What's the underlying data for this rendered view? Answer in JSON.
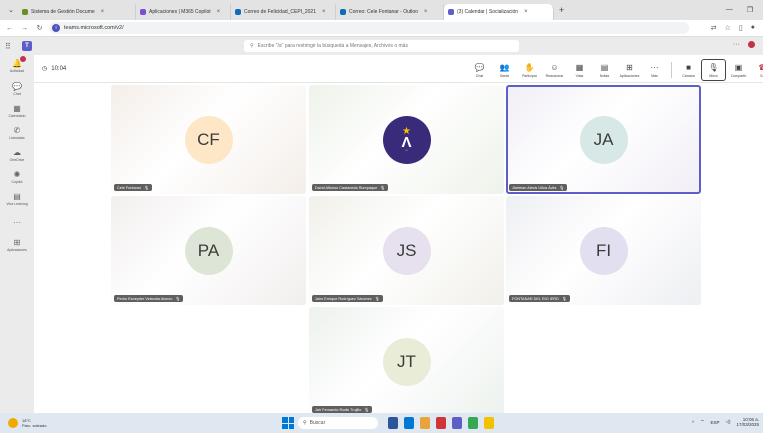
{
  "browser": {
    "tabs": [
      {
        "label": "Sistema de Gestión Docume",
        "color": "#6b8e23"
      },
      {
        "label": "Aplicaciones | M365 Copilot",
        "color": "#7a4fd6"
      },
      {
        "label": "Correo de Felicidad_CEPI_2021",
        "color": "#0f6cbd"
      },
      {
        "label": "Correo: Cele Fontanar - Outloo",
        "color": "#0f6cbd"
      },
      {
        "label": "(3) Calendar | Socialización",
        "color": "#5b5fc7",
        "active": true
      }
    ],
    "url": "teams.microsoft.com/v2/",
    "new_tab": "+"
  },
  "teams": {
    "search_placeholder": "Escribe \"/a\" para restringir la búsqueda a Mensajes, Archivos o más",
    "logo": "T",
    "rail": [
      {
        "label": "Actividad",
        "icon": "bell-icon",
        "glyph": "🔔",
        "badge": true
      },
      {
        "label": "Chat",
        "icon": "chat-icon",
        "glyph": "💬"
      },
      {
        "label": "Calendario",
        "icon": "calendar-icon",
        "glyph": "▦"
      },
      {
        "label": "Llamadas",
        "icon": "phone-icon",
        "glyph": "✆"
      },
      {
        "label": "OneDrive",
        "icon": "cloud-icon",
        "glyph": "☁"
      },
      {
        "label": "Copilot",
        "icon": "copilot-icon",
        "glyph": "✺"
      },
      {
        "label": "Viva Learning",
        "icon": "learning-icon",
        "glyph": "▤"
      },
      {
        "label": "",
        "icon": "more-icon",
        "glyph": "···"
      },
      {
        "label": "Aplicaciones",
        "icon": "apps-icon",
        "glyph": "⊞"
      }
    ]
  },
  "meeting": {
    "timer": "10:04",
    "controls": [
      {
        "label": "Chat",
        "icon": "chat-icon",
        "glyph": "💬"
      },
      {
        "label": "Gente",
        "icon": "people-icon",
        "glyph": "👥"
      },
      {
        "label": "Participar",
        "icon": "raise-hand-icon",
        "glyph": "✋"
      },
      {
        "label": "Reaccionar",
        "icon": "reaction-icon",
        "glyph": "☺"
      },
      {
        "label": "Vista",
        "icon": "view-icon",
        "glyph": "▦"
      },
      {
        "label": "Notas",
        "icon": "notes-icon",
        "glyph": "▤"
      },
      {
        "label": "Aplicaciones",
        "icon": "apps-icon",
        "glyph": "⊞"
      },
      {
        "label": "Más",
        "icon": "more-icon",
        "glyph": "···"
      }
    ],
    "device_controls": [
      {
        "label": "Cámara",
        "icon": "camera-off-icon",
        "glyph": "■"
      },
      {
        "label": "Micro",
        "icon": "mic-off-icon",
        "glyph": "🎙"
      },
      {
        "label": "Compartir",
        "icon": "share-icon",
        "glyph": "▣"
      },
      {
        "label": "Salir",
        "icon": "leave-icon",
        "glyph": "☎"
      }
    ],
    "participants": [
      {
        "initials": "CF",
        "name": "Cele Fontanar",
        "avatar_color": "#fde7c6",
        "bg": "#f4eee9"
      },
      {
        "initials": "",
        "name": "David Alfonso Castaneda Rumpaque",
        "avatar_color": "#3a2a7a",
        "bg": "#eef3ea",
        "logo": true
      },
      {
        "initials": "JA",
        "name": "Jhelman Alexis Ulloa Ávila",
        "avatar_color": "#d8e8e6",
        "bg": "#f1eef6",
        "speaking": true
      },
      {
        "initials": "PA",
        "name": "Pedro Esneyder Velandia Alonso",
        "avatar_color": "#dde6d6",
        "bg": "#f2eeee"
      },
      {
        "initials": "JS",
        "name": "Jairo Enrique Rodríguez Sánchez",
        "avatar_color": "#e6e0ef",
        "bg": "#f1f0ea"
      },
      {
        "initials": "FI",
        "name": "FONTANAR DEL RIO IERD",
        "avatar_color": "#e2e0f0",
        "bg": "#eeeff3"
      },
      {
        "initials": "JT",
        "name": "Jair Fernando Rodis Trujillo",
        "avatar_color": "#e9ecd6",
        "bg": "#edf2ee"
      }
    ]
  },
  "taskbar": {
    "weather_temp": "18°C",
    "weather_desc": "Parc. soleado",
    "search": "Buscar",
    "lang": "ESP",
    "time": "10:06 a.",
    "date": "17/03/2025",
    "app_colors": [
      "#2b579a",
      "#0078d4",
      "#e8a33c",
      "#d13438",
      "#5b5fc7",
      "#34a853",
      "#f2c200"
    ]
  }
}
